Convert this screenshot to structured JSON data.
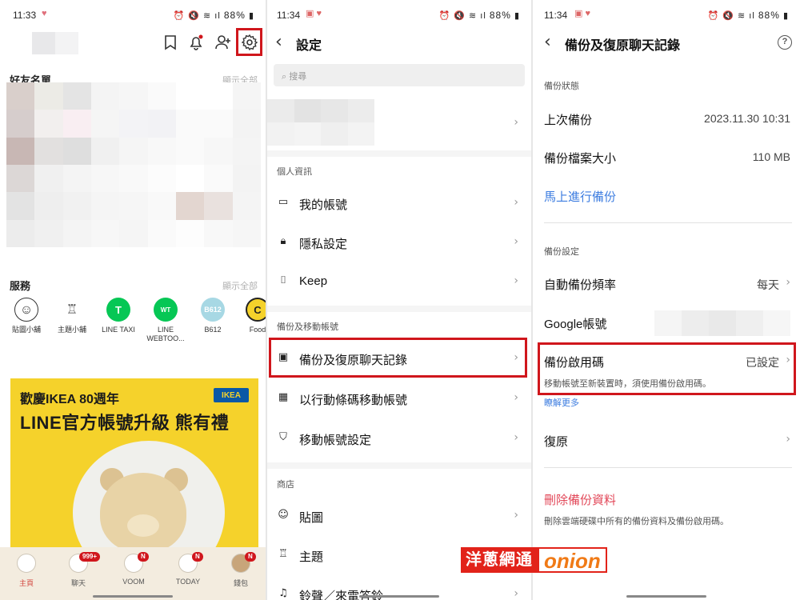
{
  "panel1": {
    "status": {
      "time": "11:33",
      "battery": "88%"
    },
    "friends": {
      "title": "好友名單",
      "see_all": "顯示全部"
    },
    "services": {
      "title": "服務",
      "see_all": "顯示全部",
      "items": [
        {
          "label": "貼圖小舖",
          "icon": "smiley-icon"
        },
        {
          "label": "主題小舖",
          "icon": "brush-icon"
        },
        {
          "label": "LINE TAXI",
          "icon": "taxi-icon"
        },
        {
          "label": "LINE WEBTOO...",
          "icon": "webtoon-icon"
        },
        {
          "label": "B612",
          "icon": "b612-icon"
        },
        {
          "label": "Food",
          "icon": "food-icon"
        }
      ]
    },
    "banner": {
      "line1": "歡慶IKEA 80週年",
      "line2": "LINE官方帳號升級 熊有禮",
      "logo": "IKEA"
    },
    "tabs": [
      {
        "label": "主頁",
        "badge": ""
      },
      {
        "label": "聊天",
        "badge": "999+"
      },
      {
        "label": "VOOM",
        "badge": "N"
      },
      {
        "label": "TODAY",
        "badge": "N"
      },
      {
        "label": "錢包",
        "badge": "N"
      }
    ]
  },
  "panel2": {
    "status": {
      "time": "11:34",
      "battery": "88%"
    },
    "title": "設定",
    "search_placeholder": "搜尋",
    "group_personal": "個人資訊",
    "rows_personal": [
      {
        "label": "我的帳號",
        "icon": "id-card-icon"
      },
      {
        "label": "隱私設定",
        "icon": "lock-icon"
      },
      {
        "label": "Keep",
        "icon": "bookmark-icon"
      }
    ],
    "group_backup": "備份及移動帳號",
    "rows_backup": [
      {
        "label": "備份及復原聊天記錄",
        "icon": "backup-folder-icon"
      },
      {
        "label": "以行動條碼移動帳號",
        "icon": "qr-code-icon"
      },
      {
        "label": "移動帳號設定",
        "icon": "shield-check-icon"
      }
    ],
    "group_store": "商店",
    "rows_store": [
      {
        "label": "貼圖",
        "icon": "smiley-icon"
      },
      {
        "label": "主題",
        "icon": "brush-icon"
      },
      {
        "label": "鈴聲／來電答鈴",
        "icon": "music-icon"
      }
    ]
  },
  "panel3": {
    "status": {
      "time": "11:34",
      "battery": "88%"
    },
    "title": "備份及復原聊天記錄",
    "status_group": "備份狀態",
    "last_backup_label": "上次備份",
    "last_backup_value": "2023.11.30 10:31",
    "file_size_label": "備份檔案大小",
    "file_size_value": "110 MB",
    "backup_now": "馬上進行備份",
    "settings_group": "備份設定",
    "auto_freq_label": "自動備份頻率",
    "auto_freq_value": "每天",
    "google_label": "Google帳號",
    "pin_label": "備份啟用碼",
    "pin_value": "已設定",
    "pin_desc": "移動帳號至新裝置時，須使用備份啟用碼。",
    "learn_more": "瞭解更多",
    "restore": "復原",
    "delete_label": "刪除備份資料",
    "delete_desc": "刪除雲端硬碟中所有的備份資料及備份啟用碼。"
  },
  "watermark": {
    "cn": "洋蔥網通",
    "en": "onion"
  }
}
